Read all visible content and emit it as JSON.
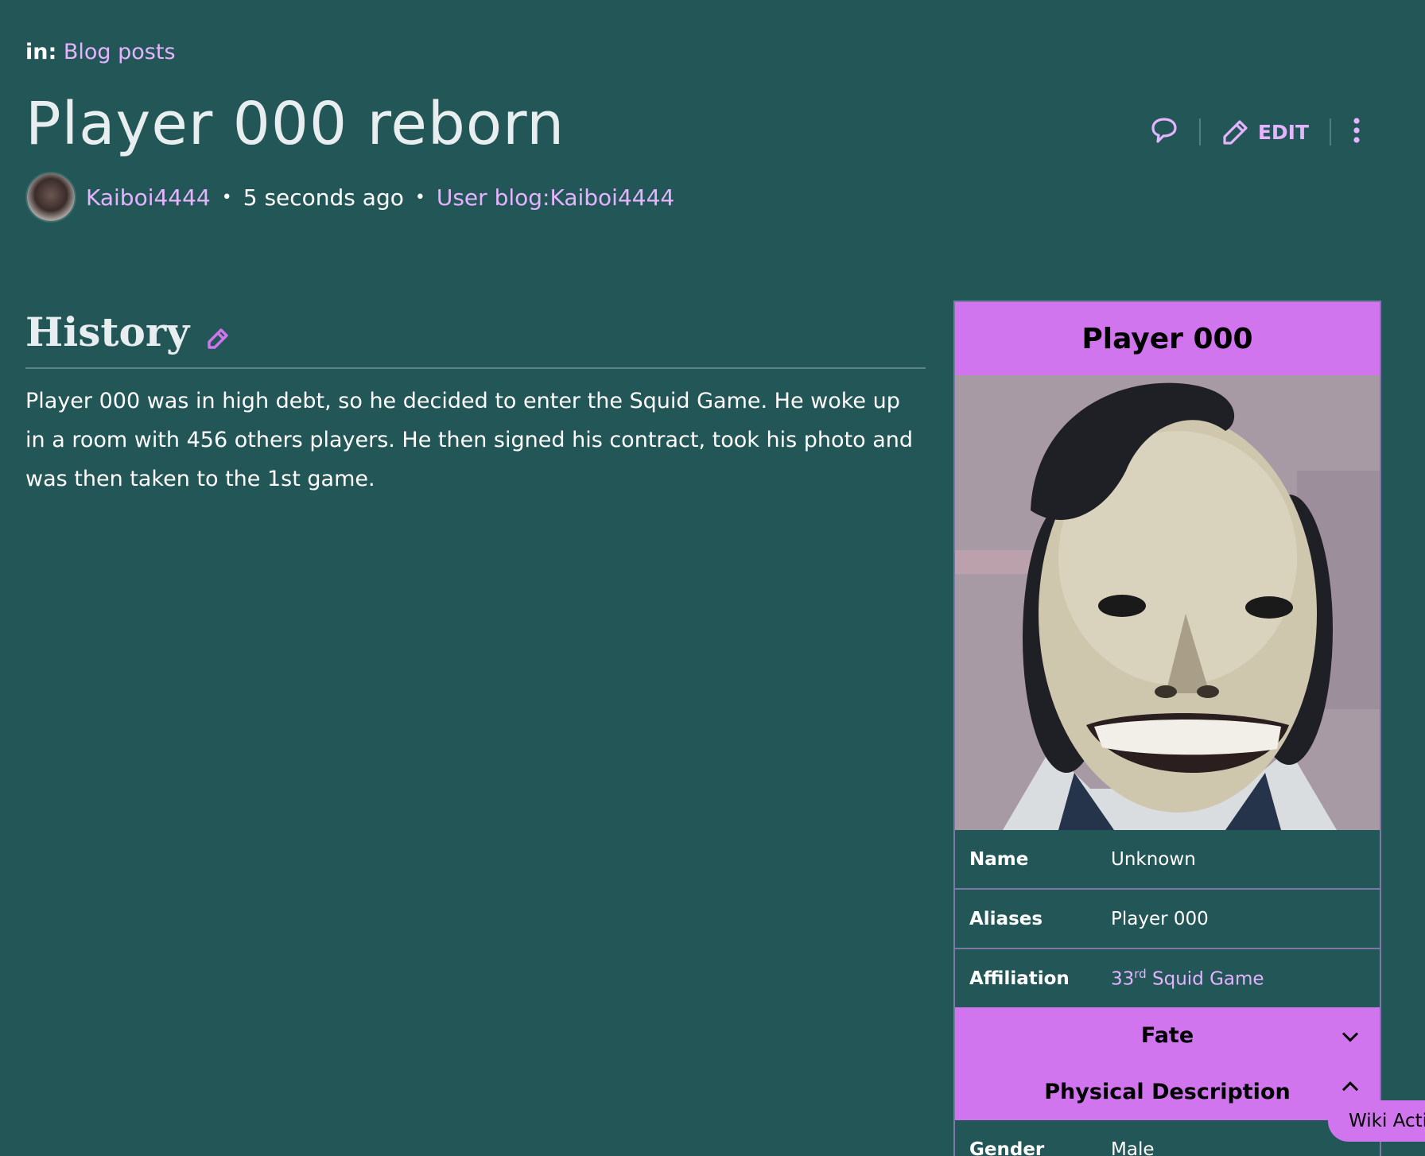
{
  "breadcrumb": {
    "prefix": "in:",
    "link": "Blog posts"
  },
  "page": {
    "title": "Player 000 reborn"
  },
  "meta": {
    "author": "Kaiboi4444",
    "time": "5 seconds ago",
    "blog": "User blog:Kaiboi4444"
  },
  "actions": {
    "edit_label": "EDIT"
  },
  "section": {
    "heading": "History",
    "text": "Player 000 was in high debt, so he decided to enter the Squid Game. He woke up in a room with 456 others players. He then signed his contract, took his photo and was then taken to the 1st game."
  },
  "infobox": {
    "title": "Player 000",
    "rows": [
      {
        "label": "Name",
        "value": "Unknown"
      },
      {
        "label": "Aliases",
        "value": "Player 000"
      },
      {
        "label": "Affiliation",
        "value_num": "33",
        "value_sup": "rd",
        "value_rest": "Squid Game"
      }
    ],
    "group_fate": "Fate",
    "group_physical": "Physical Description",
    "rows2": [
      {
        "label": "Gender",
        "value": "Male"
      }
    ]
  },
  "wiki_activity": "Wiki Activity",
  "colors": {
    "background": "#235656",
    "accent": "#d075ed",
    "link": "#e4b4ff"
  }
}
